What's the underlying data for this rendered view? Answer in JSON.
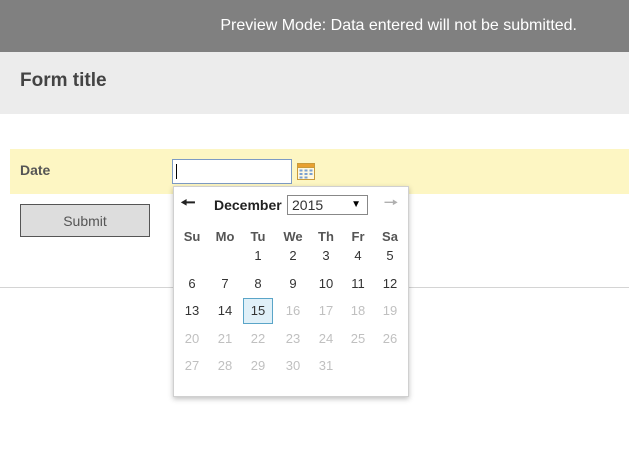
{
  "banner": {
    "text": "Preview Mode: Data entered will not be submitted."
  },
  "form": {
    "title": "Form title",
    "date_label": "Date",
    "date_value": "",
    "submit_label": "Submit"
  },
  "datepicker": {
    "month": "December",
    "year": "2015",
    "weekdays": [
      "Su",
      "Mo",
      "Tu",
      "We",
      "Th",
      "Fr",
      "Sa"
    ],
    "selected_day": "15",
    "weeks": [
      [
        "",
        "",
        "1",
        "2",
        "3",
        "4",
        "5"
      ],
      [
        "6",
        "7",
        "8",
        "9",
        "10",
        "11",
        "12"
      ],
      [
        "13",
        "14",
        "15",
        "16",
        "17",
        "18",
        "19"
      ],
      [
        "20",
        "21",
        "22",
        "23",
        "24",
        "25",
        "26"
      ],
      [
        "27",
        "28",
        "29",
        "30",
        "31",
        "",
        ""
      ]
    ],
    "disabled_after": 15,
    "prev_icon": "arrow-left-icon",
    "next_icon": "arrow-right-icon",
    "calendar_icon": "calendar-icon"
  },
  "colors": {
    "banner_bg": "#808080",
    "title_bg": "#ececec",
    "row_highlight": "#fdf6c3",
    "selected_day_bg": "#e0f0f8",
    "selected_day_border": "#5aa5c8"
  }
}
